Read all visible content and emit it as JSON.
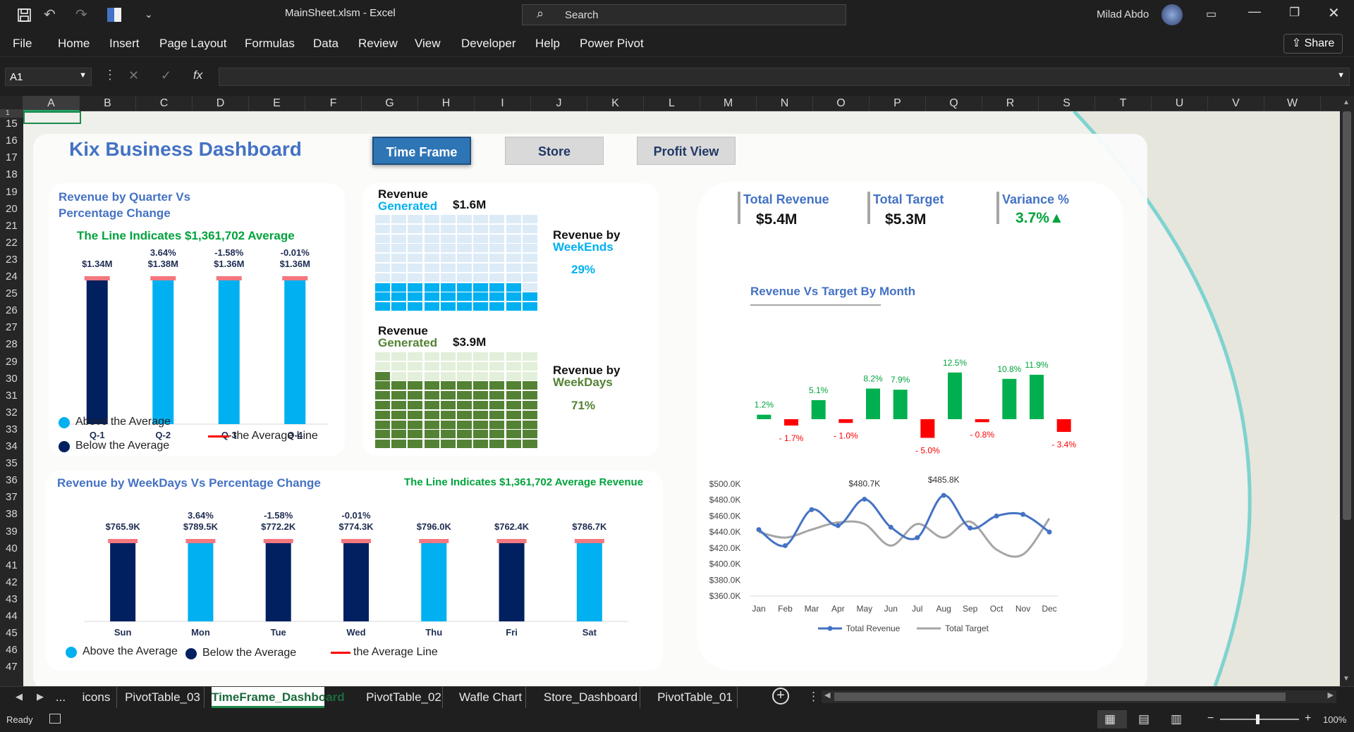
{
  "titlebar": {
    "filename": "MainSheet.xlsm",
    "sep": "-",
    "app": "Excel",
    "search_placeholder": "Search",
    "user": "Milad Abdo",
    "share": "Share"
  },
  "menu": [
    "File",
    "Home",
    "Insert",
    "Page Layout",
    "Formulas",
    "Data",
    "Review",
    "View",
    "Developer",
    "Help",
    "Power Pivot"
  ],
  "formula": {
    "cell_ref": "A1",
    "fx": "fx"
  },
  "columns": [
    "A",
    "B",
    "C",
    "D",
    "E",
    "F",
    "G",
    "H",
    "I",
    "J",
    "K",
    "L",
    "M",
    "N",
    "O",
    "P",
    "Q",
    "R",
    "S",
    "T",
    "U",
    "V",
    "W"
  ],
  "rows": [
    "1",
    "15",
    "16",
    "17",
    "18",
    "19",
    "20",
    "21",
    "22",
    "23",
    "24",
    "25",
    "26",
    "27",
    "28",
    "29",
    "30",
    "31",
    "32",
    "33",
    "34",
    "35",
    "36",
    "37",
    "38",
    "39",
    "40",
    "41",
    "42",
    "43",
    "44",
    "45",
    "46",
    "47"
  ],
  "dashboard": {
    "title": "Kix Business Dashboard",
    "buttons": [
      "Time Frame",
      "Store",
      "Profit View"
    ]
  },
  "quarter_card": {
    "title_1": "Revenue by Quarter Vs",
    "title_2": "Percentage Change",
    "subtitle": "The Line Indicates $1,361,702 Average",
    "legend_above": "Above the Average",
    "legend_below": "Below the Average",
    "legend_line": "the Average Line"
  },
  "waffle": {
    "weekend": {
      "label_1": "Revenue",
      "label_2": "Generated",
      "value": "$1.6M",
      "title_1": "Revenue by",
      "title_2": "WeekEnds",
      "pct": "29%",
      "pct_value": 29
    },
    "weekday": {
      "label_1": "Revenue",
      "label_2": "Generated",
      "value": "$3.9M",
      "title_1": "Revenue by",
      "title_2": "WeekDays",
      "pct": "71%",
      "pct_value": 71
    }
  },
  "kpis": [
    {
      "title": "Total Revenue",
      "value": "$5.4M"
    },
    {
      "title": "Total Target",
      "value": "$5.3M"
    },
    {
      "title": "Variance %",
      "value": "3.7%▲"
    }
  ],
  "variance_title": "Revenue Vs Target By Month",
  "weekday_card": {
    "title": "Revenue by WeekDays Vs Percentage Change",
    "subtitle": "The Line Indicates $1,361,702 Average Revenue",
    "legend_above": "Above the Average",
    "legend_below": "Below the Average",
    "legend_line": "the Average Line"
  },
  "sheet_tabs": [
    "...",
    "icons",
    "PivotTable_03",
    "TimeFrame_Dashboard",
    "PivotTable_02",
    "Wafle Chart",
    "Store_Dashboard",
    "PivotTable_01"
  ],
  "active_tab": "TimeFrame_Dashboard",
  "status": {
    "ready": "Ready",
    "zoom": "100%"
  },
  "colors": {
    "above": "#00b0f0",
    "below": "#002060",
    "avg_line": "#ff0000",
    "pos": "#00b050",
    "neg": "#ff0000",
    "revenue": "#4472c4",
    "target": "#a5a5a5"
  },
  "chart_data": [
    {
      "type": "bar",
      "categories": [
        "Q-1",
        "Q-2",
        "Q-3",
        "Q-4"
      ],
      "values": [
        1.34,
        1.38,
        1.36,
        1.36
      ],
      "value_labels": [
        "$1.34M",
        "$1.38M",
        "$1.36M",
        "$1.36M"
      ],
      "pct_labels": [
        "",
        "3.64%",
        "-1.58%",
        "-0.01%"
      ],
      "above_average": [
        false,
        true,
        true,
        true
      ],
      "average": 1.361702
    },
    {
      "type": "bar",
      "categories": [
        "Sun",
        "Mon",
        "Tue",
        "Wed",
        "Thu",
        "Fri",
        "Sat"
      ],
      "values": [
        765.9,
        789.5,
        772.2,
        774.3,
        796.0,
        762.4,
        786.7
      ],
      "value_labels": [
        "$765.9K",
        "$789.5K",
        "$772.2K",
        "$774.3K",
        "$796.0K",
        "$762.4K",
        "$786.7K"
      ],
      "pct_labels": [
        "",
        "3.64%",
        "-1.58%",
        "-0.01%",
        "",
        "",
        ""
      ],
      "above_average": [
        false,
        true,
        false,
        false,
        true,
        false,
        true
      ]
    },
    {
      "type": "bar",
      "categories": [
        "Jan",
        "Feb",
        "Mar",
        "Apr",
        "May",
        "Jun",
        "Jul",
        "Aug",
        "Sep",
        "Oct",
        "Nov",
        "Dec"
      ],
      "values": [
        1.2,
        -1.7,
        5.1,
        -1.0,
        8.2,
        7.9,
        -5.0,
        12.5,
        -0.8,
        10.8,
        11.9,
        -3.4
      ],
      "labels": [
        "1.2%",
        "- 1.7%",
        "5.1%",
        "- 1.0%",
        "8.2%",
        "7.9%",
        "- 5.0%",
        "12.5%",
        "- 0.8%",
        "10.8%",
        "11.9%",
        "- 3.4%"
      ]
    },
    {
      "type": "line",
      "x": [
        "Jan",
        "Feb",
        "Mar",
        "Apr",
        "May",
        "Jun",
        "Jul",
        "Aug",
        "Sep",
        "Oct",
        "Nov",
        "Dec"
      ],
      "series": [
        {
          "name": "Total Revenue",
          "values": [
            443,
            423,
            468,
            448,
            481,
            446,
            433,
            485.8,
            445,
            460,
            462,
            440
          ]
        },
        {
          "name": "Total Target",
          "values": [
            440,
            433,
            443,
            452,
            450,
            423,
            450,
            433,
            453,
            418,
            412,
            457
          ]
        }
      ],
      "annotations": [
        "$480.7K",
        "$485.8K"
      ],
      "yticks": [
        "$500.0K",
        "$480.0K",
        "$460.0K",
        "$440.0K",
        "$420.0K",
        "$400.0K",
        "$380.0K",
        "$360.0K"
      ],
      "ylim": [
        360,
        500
      ],
      "legend": "bottom"
    }
  ]
}
